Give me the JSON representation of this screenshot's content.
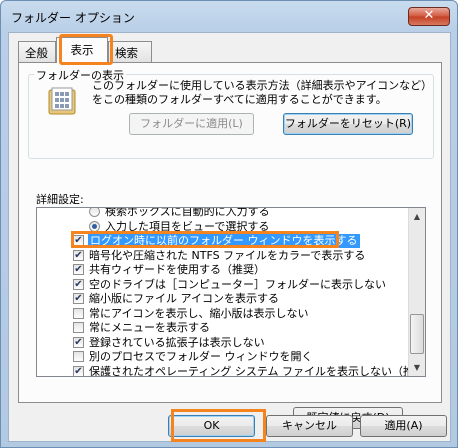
{
  "window": {
    "title": "フォルダー オプション",
    "close_glyph": "✕"
  },
  "tabs": [
    {
      "label": "全般"
    },
    {
      "label": "表示"
    },
    {
      "label": "検索"
    }
  ],
  "folder_views": {
    "group_label": "フォルダーの表示",
    "description": "このフォルダーに使用している表示方法（詳細表示やアイコンなど）をこの種類のフォルダーすべてに適用することができます。",
    "apply_button": "フォルダーに適用(L)",
    "reset_button": "フォルダーをリセット(R)"
  },
  "advanced": {
    "label": "詳細設定:",
    "items": [
      {
        "type": "radio",
        "checked": false,
        "label": "検索ボックスに自動的に入力する"
      },
      {
        "type": "radio",
        "checked": true,
        "label": "入力した項目をビューで選択する"
      },
      {
        "type": "check",
        "checked": true,
        "label": "ログオン時に以前のフォルダー ウィンドウを表示する"
      },
      {
        "type": "check",
        "checked": true,
        "label": "暗号化や圧縮された NTFS ファイルをカラーで表示する"
      },
      {
        "type": "check",
        "checked": true,
        "label": "共有ウィザードを使用する（推奨）"
      },
      {
        "type": "check",
        "checked": true,
        "label": "空のドライブは［コンピューター］フォルダーに表示しない"
      },
      {
        "type": "check",
        "checked": true,
        "label": "縮小版にファイル アイコンを表示する"
      },
      {
        "type": "check",
        "checked": false,
        "label": "常にアイコンを表示し、縮小版は表示しない"
      },
      {
        "type": "check",
        "checked": false,
        "label": "常にメニューを表示する"
      },
      {
        "type": "check",
        "checked": true,
        "label": "登録されている拡張子は表示しない"
      },
      {
        "type": "check",
        "checked": false,
        "label": "別のプロセスでフォルダー ウィンドウを開く"
      },
      {
        "type": "check",
        "checked": true,
        "label": "保護されたオペレーティング システム ファイルを表示しない（推奨）"
      }
    ],
    "restore_button": "既定値に戻す(D)"
  },
  "footer": {
    "ok": "OK",
    "cancel": "キャンセル",
    "apply": "適用(A)"
  },
  "colors": {
    "highlight": "#f5841f",
    "selection": "#3399ff"
  }
}
